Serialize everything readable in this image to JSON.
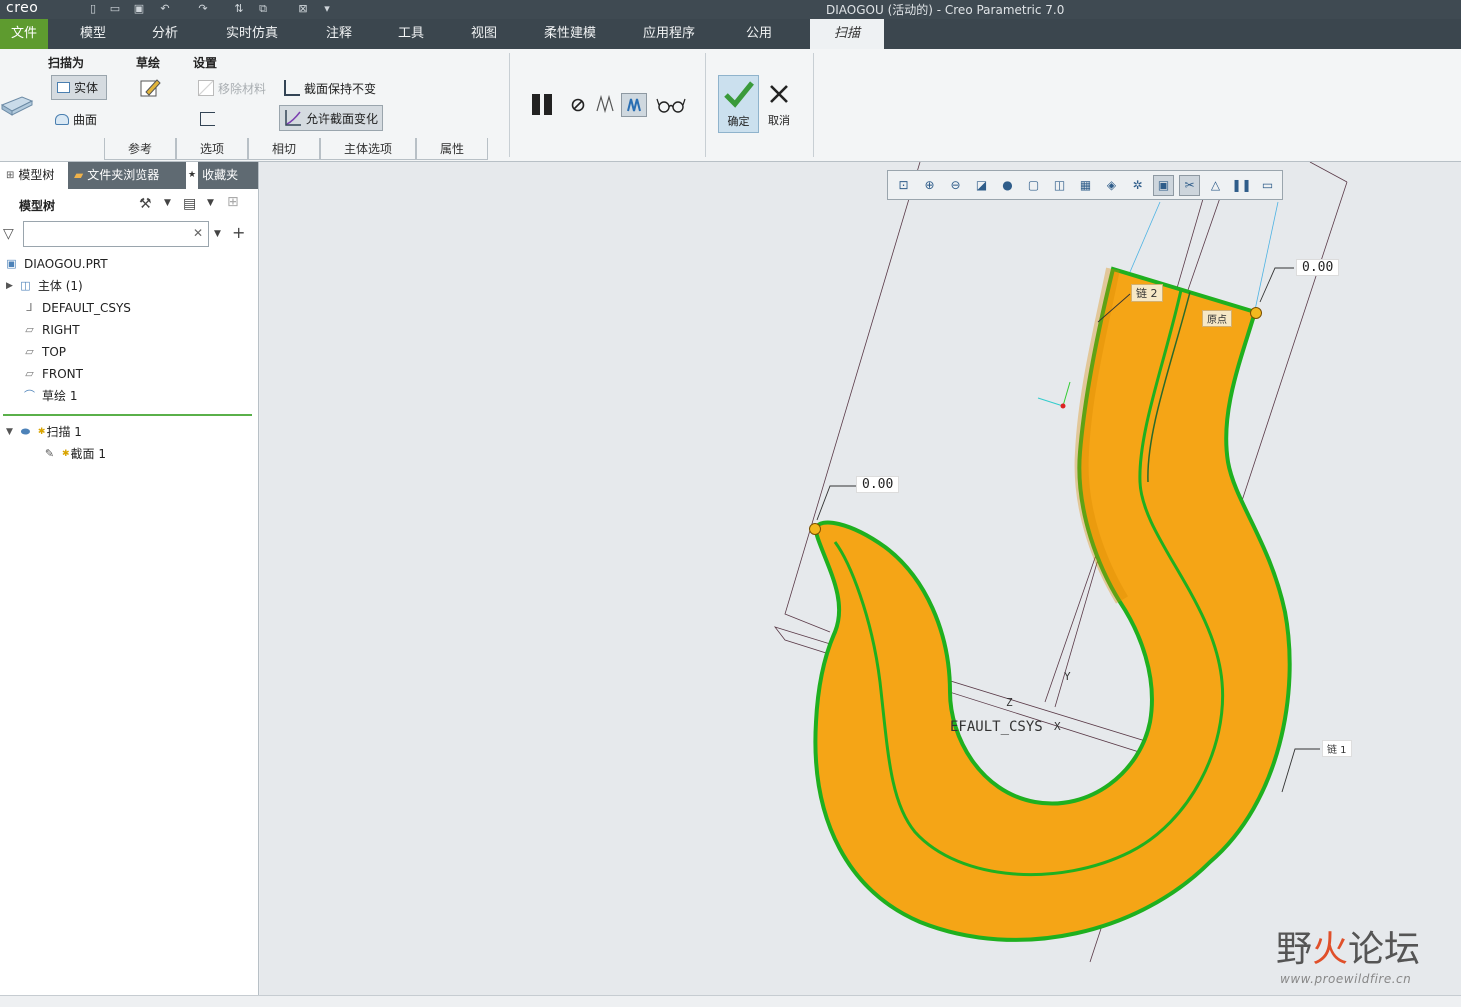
{
  "app": {
    "logo": "creo",
    "window_title": "DIAOGOU (活动的) - Creo Parametric 7.0"
  },
  "menu": {
    "items": [
      "文件",
      "模型",
      "分析",
      "实时仿真",
      "注释",
      "工具",
      "视图",
      "柔性建模",
      "应用程序",
      "公用"
    ],
    "active_tab": "扫描"
  },
  "ribbon": {
    "sweep_as": {
      "label": "扫描为",
      "solid": "实体",
      "surface": "曲面"
    },
    "sketch": {
      "label": "草绘"
    },
    "settings": {
      "label": "设置",
      "remove_material": "移除材料",
      "constant_section": "截面保持不变",
      "variable_section": "允许截面变化"
    },
    "subtabs": [
      "参考",
      "选项",
      "相切",
      "主体选项",
      "属性"
    ],
    "ok": "确定",
    "cancel": "取消"
  },
  "panel": {
    "tabs": [
      "模型树",
      "文件夹浏览器",
      "收藏夹"
    ],
    "header": "模型树",
    "search": {
      "value": "",
      "placeholder": ""
    },
    "tree": [
      {
        "label": "DIAOGOU.PRT",
        "icon": "part-icon"
      },
      {
        "label": "主体 (1)",
        "icon": "body-icon"
      },
      {
        "label": "DEFAULT_CSYS",
        "icon": "csys-icon"
      },
      {
        "label": "RIGHT",
        "icon": "plane-icon"
      },
      {
        "label": "TOP",
        "icon": "plane-icon"
      },
      {
        "label": "FRONT",
        "icon": "plane-icon"
      },
      {
        "label": "草绘 1",
        "icon": "sketch-icon"
      },
      {
        "label": "扫描 1",
        "icon": "sweep-icon"
      },
      {
        "label": "截面 1",
        "icon": "section-icon"
      }
    ]
  },
  "viewport": {
    "dim_top": "0.00",
    "dim_left": "0.00",
    "chain2": "链 2",
    "origin": "原点",
    "chain1": "链 1",
    "csys_label": "EFAULT_CSYS",
    "axis_z": "Z",
    "axis_x": "X",
    "axis_y": "Y"
  },
  "watermark": {
    "text_a": "野",
    "text_b": "火",
    "text_c": "论坛",
    "url": "www.proewildfire.cn"
  },
  "colors": {
    "hook_fill": "#f5a516",
    "hook_edge": "#1fb01f",
    "file_tab": "#5e9b2f",
    "menubar": "#3b464e"
  }
}
